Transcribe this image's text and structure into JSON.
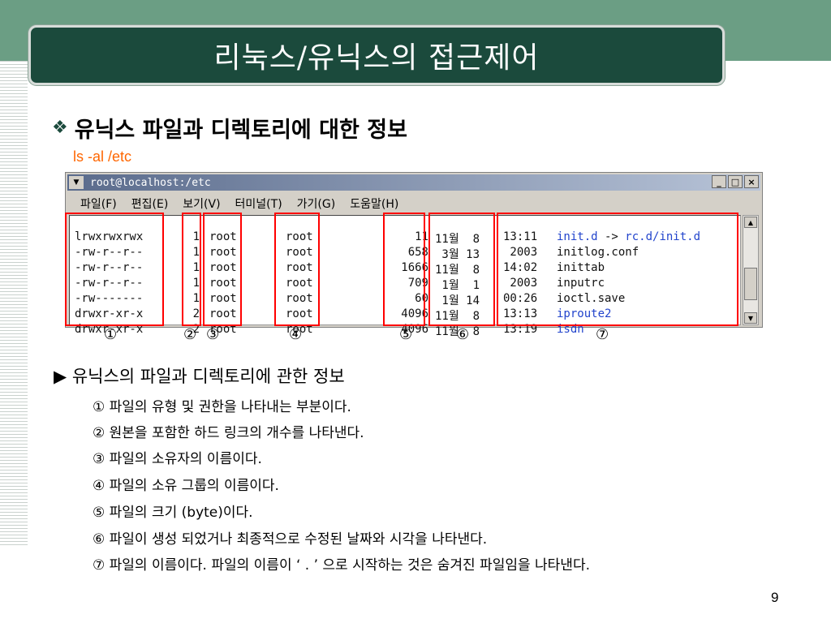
{
  "slide": {
    "title": "리눅스/유닉스의 접근제어",
    "heading": "유닉스 파일과 디렉토리에 대한 정보",
    "heading_bullet": "❖",
    "command": "ls -al /etc",
    "page_number": "9"
  },
  "terminal": {
    "window_title": "root@localhost:/etc",
    "menu": [
      "파일(F)",
      "편집(E)",
      "보기(V)",
      "터미널(T)",
      "가기(G)",
      "도움말(H)"
    ],
    "rows": [
      {
        "perm": "lrwxrwxrwx",
        "links": "1",
        "owner": "root",
        "group": "root",
        "size": "11",
        "date": "11월  8",
        "time": "13:11",
        "name": "init.d",
        "arrow": " -> ",
        "target": "rc.d/init.d"
      },
      {
        "perm": "-rw-r--r--",
        "links": "1",
        "owner": "root",
        "group": "root",
        "size": "658",
        "date": " 3월 13",
        "time": " 2003",
        "name": "initlog.conf"
      },
      {
        "perm": "-rw-r--r--",
        "links": "1",
        "owner": "root",
        "group": "root",
        "size": "1666",
        "date": "11월  8",
        "time": "14:02",
        "name": "inittab"
      },
      {
        "perm": "-rw-r--r--",
        "links": "1",
        "owner": "root",
        "group": "root",
        "size": "709",
        "date": " 1월  1",
        "time": " 2003",
        "name": "inputrc"
      },
      {
        "perm": "-rw-------",
        "links": "1",
        "owner": "root",
        "group": "root",
        "size": "60",
        "date": " 1월 14",
        "time": "00:26",
        "name": "ioctl.save"
      },
      {
        "perm": "drwxr-xr-x",
        "links": "2",
        "owner": "root",
        "group": "root",
        "size": "4096",
        "date": "11월  8",
        "time": "13:13",
        "name": "iproute2"
      },
      {
        "perm": "drwxr-xr-x",
        "links": "2",
        "owner": "root",
        "group": "root",
        "size": "4096",
        "date": "11월  8",
        "time": "13:19",
        "name": "isdn"
      }
    ]
  },
  "markers": [
    "①",
    "②",
    "③",
    "④",
    "⑤",
    "⑥",
    "⑦"
  ],
  "explanation": {
    "heading": "▶ 유닉스의 파일과 디렉토리에 관한 정보",
    "items": [
      "① 파일의 유형 및 권한을 나타내는 부분이다.",
      "② 원본을 포함한 하드 링크의 개수를 나타낸다.",
      "③ 파일의 소유자의 이름이다.",
      "④ 파일의 소유 그룹의 이름이다.",
      "⑤ 파일의 크기 (byte)이다.",
      "⑥ 파일이 생성 되었거나 최종적으로 수정된 날짜와 시각을 나타낸다.",
      "⑦ 파일의 이름이다. 파일의 이름이 ‘ . ’ 으로 시작하는 것은 숨겨진 파일임을 나타낸다."
    ]
  },
  "colors": {
    "title_bg": "#1b4a3c",
    "band": "#6b9e84",
    "command": "#ff6600",
    "highlight_box": "#ff0000",
    "link_name": "#2244cc"
  }
}
